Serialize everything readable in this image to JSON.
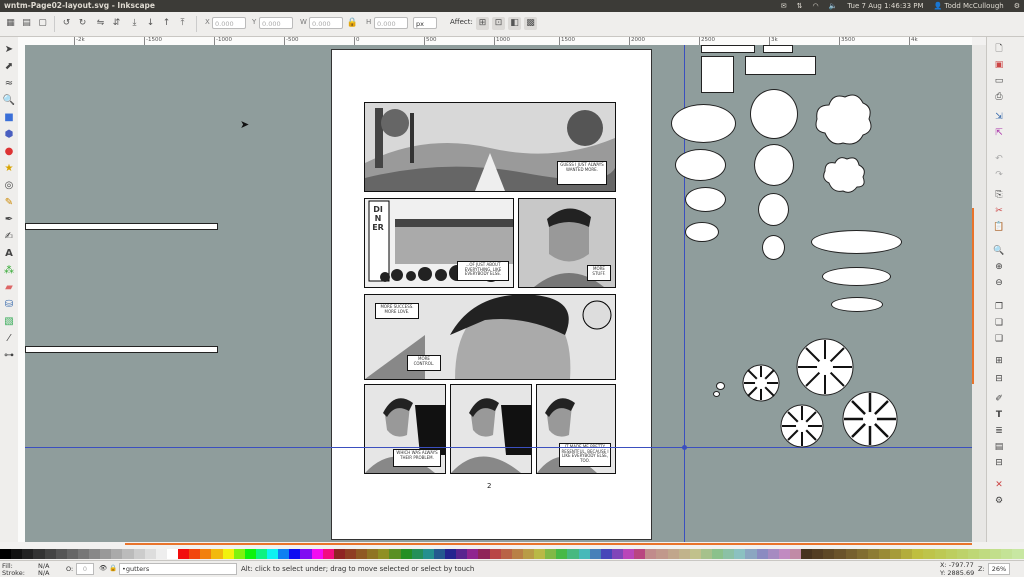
{
  "window": {
    "title": "wntm-Page02-layout.svg - Inkscape"
  },
  "tray": {
    "datetime": "Tue 7 Aug  1:46:33 PM",
    "user": "Todd McCullough"
  },
  "toolbar": {
    "x_label": "X",
    "x_value": "0.000",
    "y_label": "Y",
    "y_value": "0.000",
    "w_label": "W",
    "w_value": "0.000",
    "h_label": "H",
    "h_value": "0.000",
    "unit": "px",
    "affect_label": "Affect:"
  },
  "ruler": {
    "ticks": [
      "-2k",
      "-1500",
      "-1000",
      "-500",
      "0",
      "500",
      "1000",
      "1500",
      "2000",
      "2500",
      "3k",
      "3500",
      "4k"
    ]
  },
  "comic": {
    "page_number": "2",
    "bubbles": {
      "b1": "GUESS I JUST ALWAYS WANTED MORE.",
      "b2": "...OF JUST ABOUT EVERYTHING, LIKE EVERYBODY ELSE.",
      "b3": "MORE STUFF.",
      "b4": "MORE SUCCESS. MORE LOVE.",
      "b5": "MORE CONTROL.",
      "b6": "WHICH WAS ALWAYS THEIR PROBLEM.",
      "b7": "IT MADE ME PRETTY RESENTFUL. BECAUSE I LIKE EVERYBODY ELSE, TOO."
    },
    "sign": "DINER"
  },
  "status": {
    "fill_label": "Fill:",
    "fill_value": "N/A",
    "stroke_label": "Stroke:",
    "stroke_value": "N/A",
    "opacity_label": "O:",
    "opacity_value": "0",
    "layer": "•gutters",
    "message": "Alt: click to select under; drag to move selected or select by touch",
    "x_coord": "X: -797.77",
    "y_coord": "Y: 2885.69",
    "zoom_label": "Z:",
    "zoom": "26%"
  },
  "colors": {
    "canvas_bg": "#8f9d9c",
    "topbar_bg": "#3c3b37",
    "guide": "#3b4fbf",
    "scroll_accent": "#e9742b"
  }
}
